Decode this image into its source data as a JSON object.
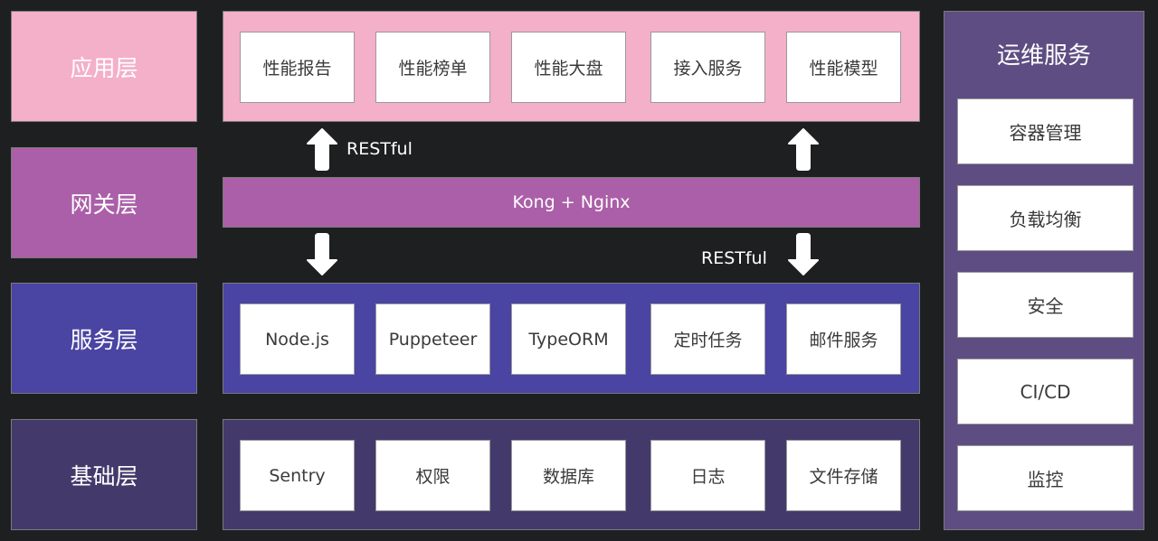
{
  "layers": [
    {
      "label": "应用层",
      "color": "#f3b0c8"
    },
    {
      "label": "网关层",
      "color": "#ab5fa8"
    },
    {
      "label": "服务层",
      "color": "#4a44a2"
    },
    {
      "label": "基础层",
      "color": "#433a6b"
    }
  ],
  "application": {
    "items": [
      "性能报告",
      "性能榜单",
      "性能大盘",
      "接入服务",
      "性能模型"
    ]
  },
  "gateway": {
    "label": "Kong + Nginx",
    "arrow_up_label": "RESTful",
    "arrow_down_label": "RESTful"
  },
  "service": {
    "items": [
      "Node.js",
      "Puppeteer",
      "TypeORM",
      "定时任务",
      "邮件服务"
    ]
  },
  "base": {
    "items": [
      "Sentry",
      "权限",
      "数据库",
      "日志",
      "文件存储"
    ]
  },
  "ops": {
    "title": "运维服务",
    "color": "#5e4d82",
    "items": [
      "容器管理",
      "负载均衡",
      "安全",
      "CI/CD",
      "监控"
    ]
  },
  "arrows": {
    "up": "arrow-up-icon",
    "down": "arrow-down-icon"
  }
}
